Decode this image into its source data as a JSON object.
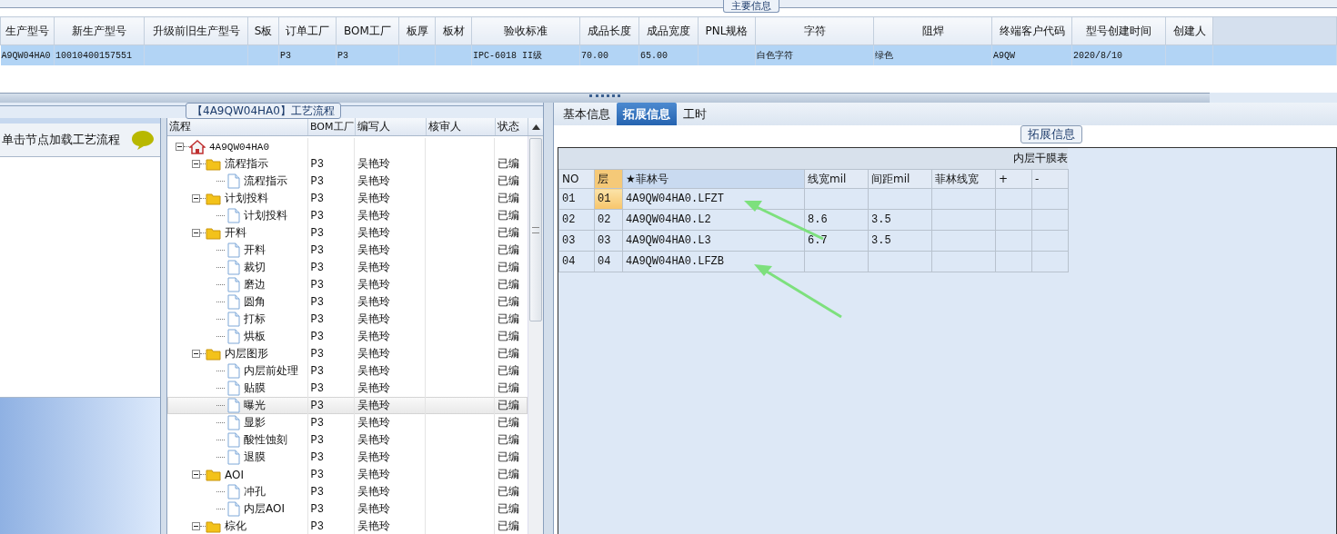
{
  "main_info": {
    "title": "主要信息",
    "columns": [
      "生产型号",
      "新生产型号",
      "升级前旧生产型号",
      "S板",
      "订单工厂",
      "BOM工厂",
      "板厚",
      "板材",
      "验收标准",
      "成品长度",
      "成品宽度",
      "PNL规格",
      "字符",
      "阻焊",
      "终端客户代码",
      "型号创建时间",
      "创建人"
    ],
    "rows": [
      {
        "selected": true,
        "cells": [
          "A9QW04HA0",
          "10010400157551",
          "",
          "",
          "P3",
          "P3",
          "",
          "",
          "IPC-6018 II级",
          "70.00",
          "65.00",
          "",
          "白色字符",
          "绿色",
          "A9QW",
          "2020/8/10",
          ""
        ]
      }
    ]
  },
  "process_panel": {
    "title": "【4A9QW04HA0】工艺流程",
    "hint": "单击节点加载工艺流程",
    "columns": [
      "流程",
      "BOM工厂",
      "编写人",
      "核审人",
      "状态"
    ],
    "tree": [
      {
        "name": "4A9QW04HA0",
        "selected": false,
        "expanded": true,
        "children": [
          {
            "name": "流程指示",
            "bom": "P3",
            "writer": "吴艳玲",
            "status": "已编",
            "selected": false,
            "expanded": true,
            "children": [
              {
                "name": "流程指示",
                "bom": "P3",
                "writer": "吴艳玲",
                "status": "已编",
                "selected": false
              }
            ]
          },
          {
            "name": "计划投料",
            "bom": "P3",
            "writer": "吴艳玲",
            "status": "已编",
            "selected": false,
            "expanded": true,
            "children": [
              {
                "name": "计划投料",
                "bom": "P3",
                "writer": "吴艳玲",
                "status": "已编",
                "selected": false
              }
            ]
          },
          {
            "name": "开料",
            "bom": "P3",
            "writer": "吴艳玲",
            "status": "已编",
            "selected": false,
            "expanded": true,
            "children": [
              {
                "name": "开料",
                "bom": "P3",
                "writer": "吴艳玲",
                "status": "已编",
                "selected": false
              },
              {
                "name": "裁切",
                "bom": "P3",
                "writer": "吴艳玲",
                "status": "已编",
                "selected": false
              },
              {
                "name": "磨边",
                "bom": "P3",
                "writer": "吴艳玲",
                "status": "已编",
                "selected": false
              },
              {
                "name": "圆角",
                "bom": "P3",
                "writer": "吴艳玲",
                "status": "已编",
                "selected": false
              },
              {
                "name": "打标",
                "bom": "P3",
                "writer": "吴艳玲",
                "status": "已编",
                "selected": false
              },
              {
                "name": "烘板",
                "bom": "P3",
                "writer": "吴艳玲",
                "status": "已编",
                "selected": false
              }
            ]
          },
          {
            "name": "内层图形",
            "bom": "P3",
            "writer": "吴艳玲",
            "status": "已编",
            "selected": false,
            "expanded": true,
            "children": [
              {
                "name": "内层前处理",
                "bom": "P3",
                "writer": "吴艳玲",
                "status": "已编",
                "selected": false
              },
              {
                "name": "贴膜",
                "bom": "P3",
                "writer": "吴艳玲",
                "status": "已编",
                "selected": false
              },
              {
                "name": "曝光",
                "bom": "P3",
                "writer": "吴艳玲",
                "status": "已编",
                "selected": true
              },
              {
                "name": "显影",
                "bom": "P3",
                "writer": "吴艳玲",
                "status": "已编",
                "selected": false
              },
              {
                "name": "酸性蚀刻",
                "bom": "P3",
                "writer": "吴艳玲",
                "status": "已编",
                "selected": false
              },
              {
                "name": "退膜",
                "bom": "P3",
                "writer": "吴艳玲",
                "status": "已编",
                "selected": false
              }
            ]
          },
          {
            "name": "AOI",
            "bom": "P3",
            "writer": "吴艳玲",
            "status": "已编",
            "selected": false,
            "expanded": true,
            "children": [
              {
                "name": "冲孔",
                "bom": "P3",
                "writer": "吴艳玲",
                "status": "已编",
                "selected": false
              },
              {
                "name": "内层AOI",
                "bom": "P3",
                "writer": "吴艳玲",
                "status": "已编",
                "selected": false
              }
            ]
          },
          {
            "name": "棕化",
            "bom": "P3",
            "writer": "吴艳玲",
            "status": "已编",
            "selected": false,
            "expanded": true
          }
        ]
      }
    ]
  },
  "detail": {
    "tabs": [
      {
        "label": "基本信息",
        "selected": false
      },
      {
        "label": "拓展信息",
        "selected": true
      },
      {
        "label": "工时",
        "selected": false
      }
    ],
    "group_title": "拓展信息",
    "table_title": "内层干膜表",
    "columns": [
      "NO",
      "层",
      "★菲林号",
      "线宽mil",
      "间距mil",
      "菲林线宽",
      "+",
      "-"
    ],
    "rows": [
      {
        "selected": true,
        "cells": [
          "01",
          "01",
          "4A9QW04HA0.LFZT",
          "",
          "",
          "",
          "",
          ""
        ]
      },
      {
        "selected": false,
        "cells": [
          "02",
          "02",
          "4A9QW04HA0.L2",
          "8.6",
          "3.5",
          "",
          "",
          ""
        ]
      },
      {
        "selected": false,
        "cells": [
          "03",
          "03",
          "4A9QW04HA0.L3",
          "6.7",
          "3.5",
          "",
          "",
          ""
        ]
      },
      {
        "selected": false,
        "cells": [
          "04",
          "04",
          "4A9QW04HA0.LFZB",
          "",
          "",
          "",
          "",
          ""
        ]
      }
    ]
  }
}
